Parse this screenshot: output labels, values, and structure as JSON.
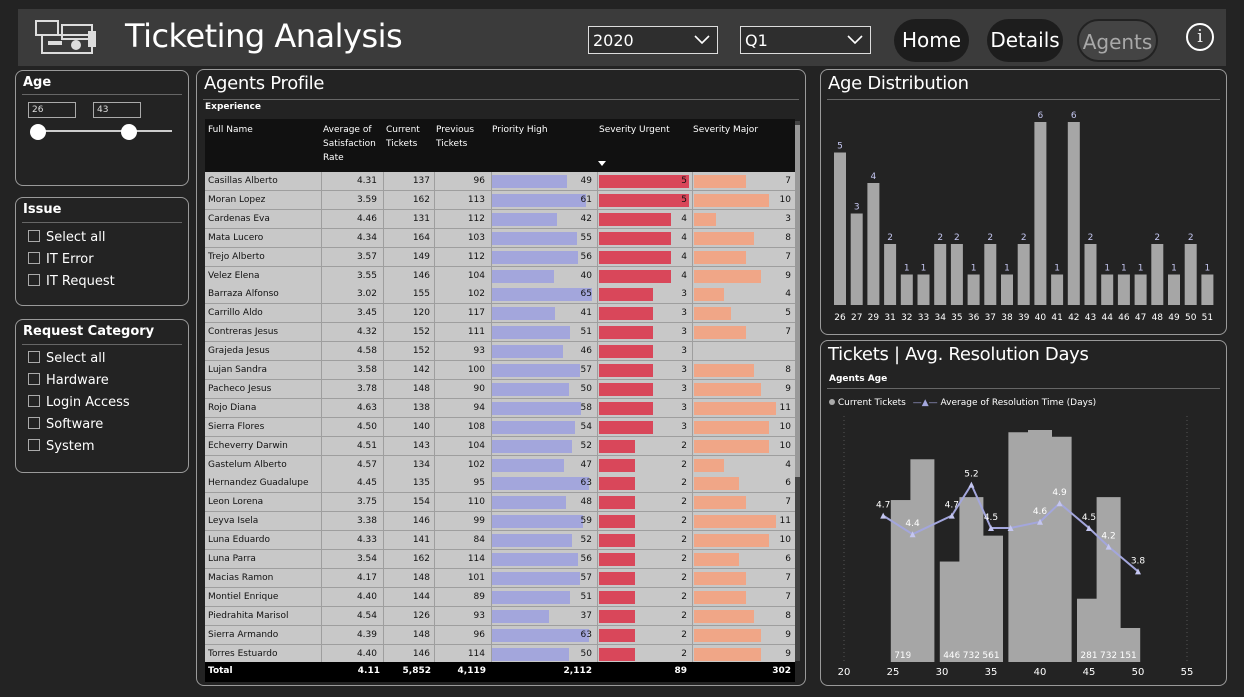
{
  "header": {
    "title": "Ticketing Analysis",
    "year_value": "2020",
    "quarter_value": "Q1",
    "nav": [
      "Home",
      "Details",
      "Agents"
    ],
    "active_nav": "Agents",
    "info_label": "i"
  },
  "filters": {
    "age": {
      "title": "Age",
      "min": "26",
      "max": "43"
    },
    "issue": {
      "title": "Issue",
      "items": [
        "Select all",
        "IT Error",
        "IT Request"
      ]
    },
    "request_category": {
      "title": "Request Category",
      "items": [
        "Select all",
        "Hardware",
        "Login Access",
        "Software",
        "System"
      ]
    }
  },
  "agents_profile": {
    "title": "Agents Profile",
    "subtitle": "Experience",
    "columns": [
      "Full Name",
      "Average of Satisfaction Rate",
      "Current Tickets",
      "Previous Tickets",
      "Priority High",
      "Severity Urgent",
      "Severity Major"
    ],
    "rows": [
      [
        "Casillas Alberto",
        "4.31",
        "137",
        "96",
        "49",
        "5",
        "7"
      ],
      [
        "Moran Lopez",
        "3.59",
        "162",
        "113",
        "61",
        "5",
        "10"
      ],
      [
        "Cardenas Eva",
        "4.46",
        "131",
        "112",
        "42",
        "4",
        "3"
      ],
      [
        "Mata Lucero",
        "4.34",
        "164",
        "103",
        "55",
        "4",
        "8"
      ],
      [
        "Trejo Alberto",
        "3.57",
        "149",
        "112",
        "56",
        "4",
        "7"
      ],
      [
        "Velez Elena",
        "3.55",
        "146",
        "104",
        "40",
        "4",
        "9"
      ],
      [
        "Barraza Alfonso",
        "3.02",
        "155",
        "102",
        "65",
        "3",
        "4"
      ],
      [
        "Carrillo Aldo",
        "3.45",
        "120",
        "117",
        "41",
        "3",
        "5"
      ],
      [
        "Contreras Jesus",
        "4.32",
        "152",
        "111",
        "51",
        "3",
        "7"
      ],
      [
        "Grajeda Jesus",
        "4.58",
        "152",
        "93",
        "46",
        "3",
        ""
      ],
      [
        "Lujan Sandra",
        "3.58",
        "142",
        "100",
        "57",
        "3",
        "8"
      ],
      [
        "Pacheco Jesus",
        "3.78",
        "148",
        "90",
        "50",
        "3",
        "9"
      ],
      [
        "Rojo Diana",
        "4.63",
        "138",
        "94",
        "58",
        "3",
        "11"
      ],
      [
        "Sierra Flores",
        "4.50",
        "140",
        "108",
        "54",
        "3",
        "10"
      ],
      [
        "Echeverry Darwin",
        "4.51",
        "143",
        "104",
        "52",
        "2",
        "10"
      ],
      [
        "Gastelum Alberto",
        "4.57",
        "134",
        "102",
        "47",
        "2",
        "4"
      ],
      [
        "Hernandez Guadalupe",
        "4.45",
        "135",
        "95",
        "63",
        "2",
        "6"
      ],
      [
        "Leon Lorena",
        "3.75",
        "154",
        "110",
        "48",
        "2",
        "7"
      ],
      [
        "Leyva Isela",
        "3.38",
        "146",
        "99",
        "59",
        "2",
        "11"
      ],
      [
        "Luna Eduardo",
        "4.33",
        "141",
        "84",
        "52",
        "2",
        "10"
      ],
      [
        "Luna Parra",
        "3.54",
        "162",
        "114",
        "56",
        "2",
        "6"
      ],
      [
        "Macias Ramon",
        "4.17",
        "148",
        "101",
        "57",
        "2",
        "7"
      ],
      [
        "Montiel Enrique",
        "4.40",
        "144",
        "89",
        "51",
        "2",
        "7"
      ],
      [
        "Piedrahita Marisol",
        "4.54",
        "126",
        "93",
        "37",
        "2",
        "8"
      ],
      [
        "Sierra Armando",
        "4.39",
        "148",
        "96",
        "63",
        "2",
        "9"
      ],
      [
        "Torres Estuardo",
        "4.40",
        "146",
        "114",
        "50",
        "2",
        "9"
      ]
    ],
    "total": [
      "Total",
      "4.11",
      "5,852",
      "4,119",
      "2,112",
      "89",
      "302"
    ],
    "colors": {
      "priority_high": "#a3a6dc",
      "severity_urgent": "#d9475a",
      "severity_major": "#f0a687"
    }
  },
  "chart_data": [
    {
      "type": "bar",
      "title": "Age Distribution",
      "categories": [
        "26",
        "27",
        "29",
        "31",
        "32",
        "33",
        "34",
        "35",
        "36",
        "37",
        "38",
        "39",
        "40",
        "41",
        "42",
        "43",
        "44",
        "46",
        "47",
        "48",
        "49",
        "50",
        "51"
      ],
      "values": [
        5,
        3,
        4,
        2,
        1,
        1,
        2,
        2,
        1,
        2,
        1,
        2,
        6,
        1,
        6,
        2,
        1,
        1,
        1,
        2,
        1,
        2,
        1
      ],
      "ylim": [
        0,
        6
      ]
    },
    {
      "type": "bar",
      "title": "Tickets | Avg. Resolution Days",
      "subtitle": "Agents Age",
      "legend": [
        "Current Tickets",
        "Average of Resolution Time (Days)"
      ],
      "legend_position": "top-left",
      "x_ticks": [
        "20",
        "25",
        "30",
        "35",
        "40",
        "45",
        "50",
        "55"
      ],
      "series": [
        {
          "name": "Current Tickets",
          "type": "bar",
          "x": [
            26,
            28,
            31,
            33,
            35,
            38,
            40,
            42,
            45,
            47,
            49
          ],
          "values": [
            719,
            900,
            446,
            732,
            561,
            1020,
            1030,
            1000,
            281,
            732,
            151
          ]
        },
        {
          "name": "Average of Resolution Time (Days)",
          "type": "line",
          "x": [
            24,
            27,
            31,
            33,
            35,
            37,
            40,
            42,
            45,
            47,
            50
          ],
          "values": [
            4.7,
            4.4,
            4.7,
            5.2,
            4.5,
            4.5,
            4.6,
            4.9,
            4.5,
            4.2,
            3.8
          ]
        }
      ],
      "bar_value_labels": [
        "719",
        "",
        "446",
        "732",
        "561",
        "",
        "",
        "",
        "281",
        "732",
        "151"
      ],
      "line_value_labels": [
        "4.7",
        "4.4",
        "4.7",
        "5.2",
        "4.5",
        "",
        "4.6",
        "4.9",
        "4.5",
        "4.2",
        "3.8"
      ]
    }
  ]
}
